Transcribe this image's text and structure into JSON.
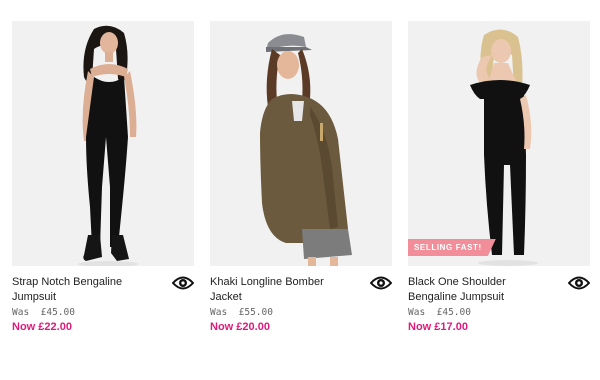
{
  "products": [
    {
      "title": "Strap Notch Bengaline Jumpsuit",
      "was_label": "Was",
      "was_price": "£45.00",
      "now_label": "Now",
      "now_price": "£22.00",
      "badge": "",
      "icon": "quick-view-eye-icon"
    },
    {
      "title": "Khaki Longline Bomber Jacket",
      "was_label": "Was",
      "was_price": "£55.00",
      "now_label": "Now",
      "now_price": "£20.00",
      "badge": "",
      "icon": "quick-view-eye-icon"
    },
    {
      "title": "Black One Shoulder Bengaline Jumpsuit",
      "was_label": "Was",
      "was_price": "£45.00",
      "now_label": "Now",
      "now_price": "£17.00",
      "badge": "SELLING FAST!",
      "icon": "quick-view-eye-icon"
    }
  ],
  "colors": {
    "sale_price": "#e0197a",
    "badge_bg": "#f28e99",
    "photo_bg": "#f1f1f1"
  }
}
